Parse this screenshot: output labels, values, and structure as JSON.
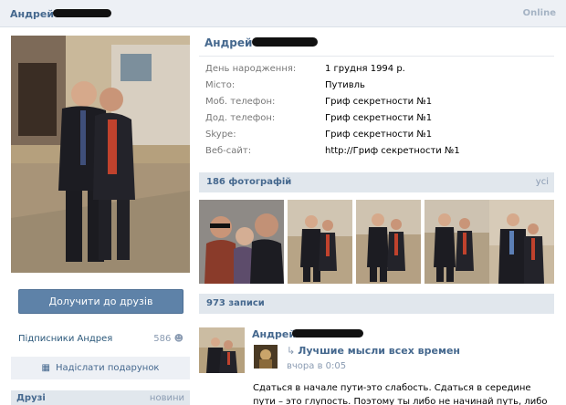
{
  "header": {
    "name": "Андрей",
    "status": "Online"
  },
  "profile": {
    "name": "Андрей",
    "info": [
      {
        "label": "День народження:",
        "value": "1 грудня 1994 р."
      },
      {
        "label": "Місто:",
        "value": "Путивль"
      },
      {
        "label": "Моб. телефон:",
        "value": "Гриф секретности №1"
      },
      {
        "label": "Дод. телефон:",
        "value": "Гриф секретности №1"
      },
      {
        "label": "Skype:",
        "value": "Гриф секретности №1"
      },
      {
        "label": "Веб-сайт:",
        "value": "http://Гриф секретности №1"
      }
    ]
  },
  "sidebar": {
    "add_friend_label": "Долучити до друзів",
    "subscribers_label": "Підписники Андрея",
    "subscribers_count": "586",
    "gift_label": "Надіслати подарунок",
    "friends_title": "Друзі",
    "friends_link": "новини"
  },
  "photos": {
    "title": "186 фотографій",
    "all_link": "усі"
  },
  "wall": {
    "title": "973 записи",
    "post": {
      "author": "Андрей",
      "repost_title": "Лучшие мысли всех времен",
      "time": "вчора в 0:05",
      "text": "Сдаться в начале пути-это слабость. Сдаться в середине пути – это глупость. Поэтому ты либо не начинай путь, либо иди до"
    }
  }
}
